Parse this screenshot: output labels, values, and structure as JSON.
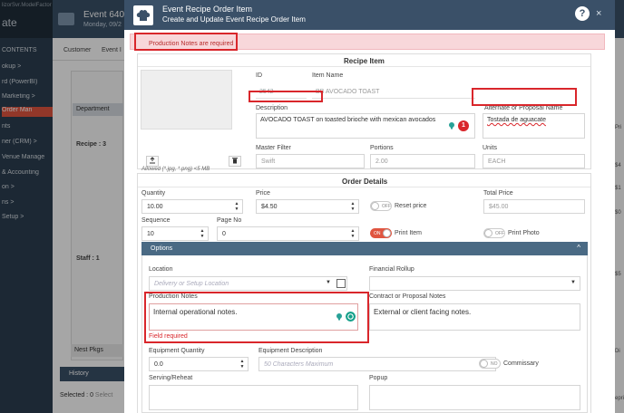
{
  "background": {
    "logo_text": "ate",
    "logo_sub": "lizorSvr.ModelFactor",
    "header_title": "Event 6405",
    "header_subtitle": "Monday, 09/2",
    "nav": [
      "CONTENTS",
      "okup >",
      "rd (PowerBI)",
      "Marketing >",
      "Order Man",
      "nts",
      "ner (CRM) >",
      "Venue Manage",
      "& Accounting",
      "on >",
      "ns >",
      "Setup >"
    ],
    "tab_customer": "Customer",
    "tab_event": "Event I",
    "department": "Department",
    "recipe_group": "Recipe : 3",
    "staff_group": "Staff : 1",
    "nest_pkgs": "Nest Pkgs",
    "history": "History",
    "selected": "Selected : 0",
    "selected_more": "Select",
    "right_labels": [
      "Pri",
      "$4",
      "$1",
      "$0",
      "$5",
      "Di",
      "epri"
    ]
  },
  "modal": {
    "title": "Event Recipe Order Item",
    "subtitle": "Create and Update Event Recipe Order Item",
    "help": "?",
    "close": "×"
  },
  "alert": {
    "text": "Production Notes are required"
  },
  "recipe_item": {
    "section_title": "Recipe Item",
    "id_label": "ID",
    "id_value": "2542",
    "item_name_label": "Item Name",
    "item_name_value": "BB AVOCADO TOAST",
    "description_label": "Description",
    "description_value": "AVOCADO TOAST on toasted brioche with mexican avocados",
    "description_badge_count": "1",
    "alternate_label": "Alternate or Proposal Name",
    "alternate_value": "Tostada de aguacate",
    "image_caption": "Allowed (*.jpg, *.png) <5 MB",
    "master_filter_label": "Master Filter",
    "master_filter_value": "Swift",
    "portions_label": "Portions",
    "portions_value": "2.00",
    "units_label": "Units",
    "units_value": "EACH"
  },
  "order_details": {
    "section_title": "Order Details",
    "quantity_label": "Quantity",
    "quantity_value": "10.00",
    "price_label": "Price",
    "price_value": "$4.50",
    "reset_price_label": "Reset price",
    "reset_price_toggle": "OFF",
    "total_price_label": "Total Price",
    "total_price_value": "$45.00",
    "sequence_label": "Sequence",
    "sequence_value": "10",
    "page_no_label": "Page No",
    "page_no_value": "0",
    "print_item_label": "Print Item",
    "print_item_toggle": "ON",
    "print_photo_label": "Print Photo",
    "print_photo_toggle": "OFF"
  },
  "options": {
    "bar_label": "Options",
    "location_label": "Location",
    "location_placeholder": "Delivery or Setup Location",
    "financial_rollup_label": "Financial Rollup",
    "production_notes_label": "Production Notes",
    "production_notes_placeholder": "Internal operational notes.",
    "production_notes_error": "Field required",
    "contract_notes_label": "Contract or Proposal Notes",
    "contract_notes_placeholder": "External or client facing notes.",
    "equipment_quantity_label": "Equipment Quantity",
    "equipment_quantity_value": "0.0",
    "equipment_description_label": "Equipment Description",
    "equipment_description_placeholder": "50 Characters Maximum",
    "commissary_label": "Commissary",
    "commissary_toggle": "NO",
    "serving_label": "Serving/Reheat",
    "popup_label": "Popup"
  },
  "colors": {
    "header": "#3a5068",
    "alert_bg": "#f8d7da",
    "error": "#d9262b",
    "toggle_on": "#e05540",
    "options_bar": "#4a6a84"
  }
}
